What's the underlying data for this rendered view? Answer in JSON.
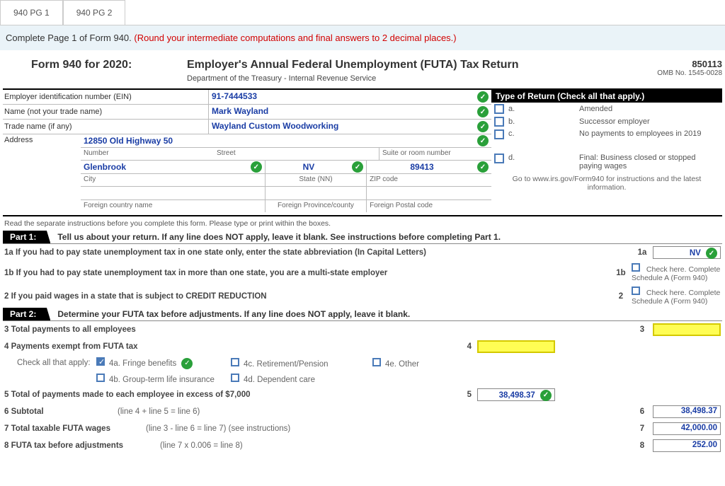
{
  "tabs": [
    "940 PG 1",
    "940 PG 2"
  ],
  "instructions": {
    "prefix": "Complete Page 1 of Form 940. ",
    "warning": "(Round your intermediate computations and final answers to 2 decimal places.)"
  },
  "header": {
    "form_title": "Form 940 for 2020:",
    "main_title": "Employer's Annual Federal Unemployment (FUTA) Tax Return",
    "dept": "Department of the Treasury - Internal Revenue Service",
    "seq": "850113",
    "omb": "OMB No. 1545-0028"
  },
  "employer": {
    "ein_label": "Employer identification number (EIN)",
    "ein": "91-7444533",
    "name_label": "Name (not your trade name)",
    "name": "Mark Wayland",
    "trade_label": "Trade name (if any)",
    "trade": "Wayland Custom Woodworking",
    "address_label": "Address",
    "street": "12850 Old Highway 50",
    "number_lbl": "Number",
    "street_lbl": "Street",
    "suite_lbl": "Suite or room number",
    "city": "Glenbrook",
    "city_lbl": "City",
    "state": "NV",
    "state_lbl": "State (NN)",
    "zip": "89413",
    "zip_lbl": "ZIP code",
    "fcountry_lbl": "Foreign country name",
    "fprov_lbl": "Foreign Province/county",
    "fpostal_lbl": "Foreign Postal code"
  },
  "type_return": {
    "header": "Type of Return (Check all that apply.)",
    "a": "a.",
    "a_text": "Amended",
    "b": "b.",
    "b_text": "Successor employer",
    "c": "c.",
    "c_text": "No payments to employees in 2019",
    "d": "d.",
    "d_text": "Final:  Business closed or stopped paying wages",
    "info": "Go to www.irs.gov/Form940 for instructions and the latest information."
  },
  "read_instr": "Read the separate instructions before you complete this form. Please type or print within the boxes.",
  "part1": {
    "label": "Part 1:",
    "desc": "Tell us about your return. If any line does NOT apply, leave it blank. See instructions before completing Part 1.",
    "l1a": "1a If you had to pay state unemployment tax in one state only, enter the state abbreviation (In Capital Letters)",
    "l1a_num": "1a",
    "l1a_val": "NV",
    "l1b": "1b If you had to pay state unemployment tax in more than one state, you are a multi-state employer",
    "l1b_num": "1b",
    "l1b_text": "Check here. Complete Schedule A (Form 940)",
    "l2": "2   If you paid wages in a state that is subject to CREDIT REDUCTION",
    "l2_num": "2",
    "l2_text": "Check here. Complete Schedule A (Form 940)"
  },
  "part2": {
    "label": "Part 2:",
    "desc": "Determine your FUTA tax before adjustments.  If any line does NOT apply, leave it blank.",
    "l3": "3   Total payments to all employees",
    "l3_num": "3",
    "l4": "4   Payments exempt from FUTA tax",
    "l4_num": "4",
    "check_label": "Check all that apply:",
    "l4a": "4a. Fringe benefits",
    "l4b": "4b. Group-term life insurance",
    "l4c": "4c. Retirement/Pension",
    "l4d": "4d. Dependent care",
    "l4e": "4e. Other",
    "l5": "5   Total of payments made to each employee in excess of $7,000",
    "l5_num": "5",
    "l5_val": "38,498.37",
    "l6": "6   Subtotal",
    "l6_sub": "(line 4 + line 5 = line 6)",
    "l6_num": "6",
    "l6_val": "38,498.37",
    "l7": "7   Total taxable FUTA wages",
    "l7_sub": "(line 3 - line 6 = line 7) (see instructions)",
    "l7_num": "7",
    "l7_val": "42,000.00",
    "l8": "8   FUTA tax before adjustments",
    "l8_sub": "(line 7 x 0.006 = line 8)",
    "l8_num": "8",
    "l8_val": "252.00"
  }
}
